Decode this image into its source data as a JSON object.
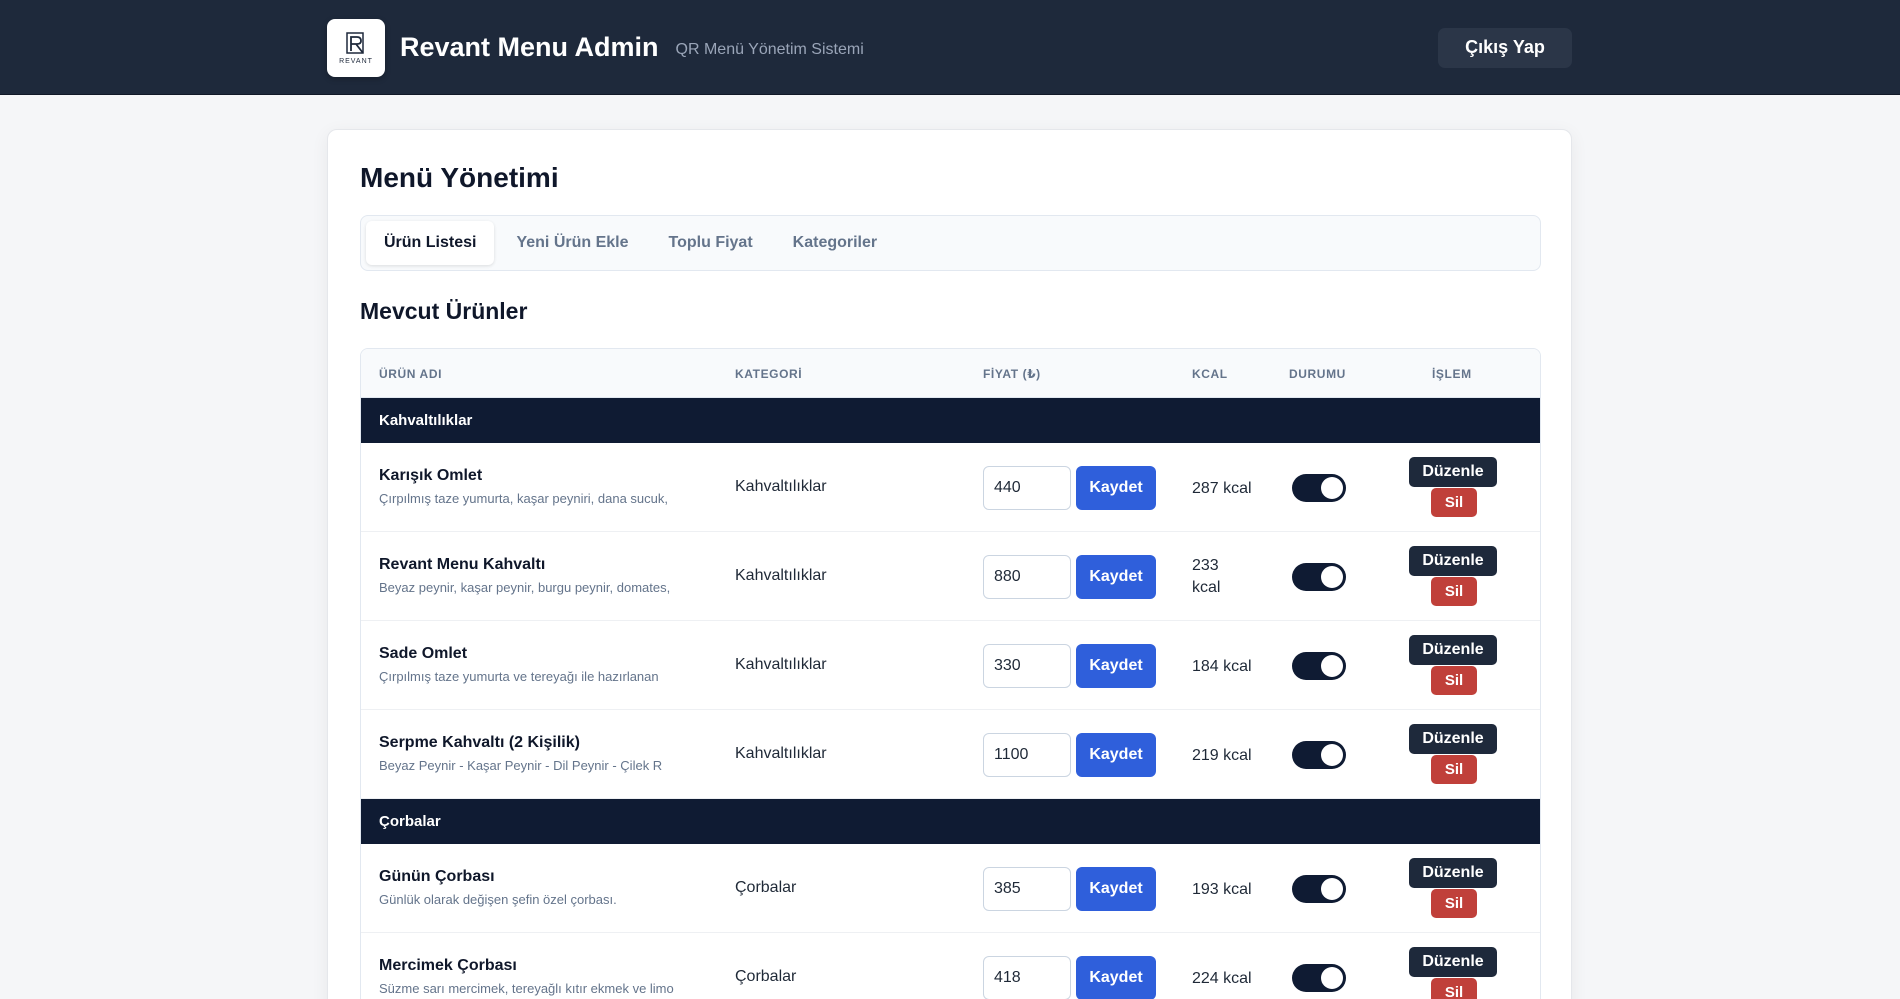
{
  "header": {
    "logo_text": "REVANT",
    "title": "Revant Menu Admin",
    "subtitle": "QR Menü Yönetim Sistemi",
    "logout_label": "Çıkış Yap"
  },
  "main": {
    "title": "Menü Yönetimi",
    "tabs": [
      {
        "label": "Ürün Listesi",
        "active": true
      },
      {
        "label": "Yeni Ürün Ekle",
        "active": false
      },
      {
        "label": "Toplu Fiyat",
        "active": false
      },
      {
        "label": "Kategoriler",
        "active": false
      }
    ],
    "section_title": "Mevcut Ürünler"
  },
  "table": {
    "columns": [
      "ÜRÜN ADI",
      "KATEGORİ",
      "FİYAT (₺)",
      "KCAL",
      "DURUMU",
      "İŞLEM"
    ],
    "save_label": "Kaydet",
    "edit_label": "Düzenle",
    "delete_label": "Sil",
    "groups": [
      {
        "name": "Kahvaltılıklar",
        "items": [
          {
            "name": "Karışık Omlet",
            "desc": "Çırpılmış taze yumurta, kaşar peyniri, dana sucuk,",
            "category": "Kahvaltılıklar",
            "price": "440",
            "kcal": "287 kcal",
            "active": true
          },
          {
            "name": "Revant Menu Kahvaltı",
            "desc": "Beyaz peynir, kaşar peynir, burgu peynir, domates,",
            "category": "Kahvaltılıklar",
            "price": "880",
            "kcal": "233 kcal",
            "active": true
          },
          {
            "name": "Sade Omlet",
            "desc": "Çırpılmış taze yumurta ve tereyağı ile hazırlanan",
            "category": "Kahvaltılıklar",
            "price": "330",
            "kcal": "184 kcal",
            "active": true
          },
          {
            "name": "Serpme Kahvaltı (2 Kişilik)",
            "desc": "Beyaz Peynir - Kaşar Peynir - Dil Peynir - Çilek R",
            "category": "Kahvaltılıklar",
            "price": "1100",
            "kcal": "219 kcal",
            "active": true
          }
        ]
      },
      {
        "name": "Çorbalar",
        "items": [
          {
            "name": "Günün Çorbası",
            "desc": "Günlük olarak değişen şefin özel çorbası.",
            "category": "Çorbalar",
            "price": "385",
            "kcal": "193 kcal",
            "active": true
          },
          {
            "name": "Mercimek Çorbası",
            "desc": "Süzme sarı mercimek, tereyağlı kıtır ekmek ve limo",
            "category": "Çorbalar",
            "price": "418",
            "kcal": "224 kcal",
            "active": true
          }
        ]
      }
    ]
  }
}
